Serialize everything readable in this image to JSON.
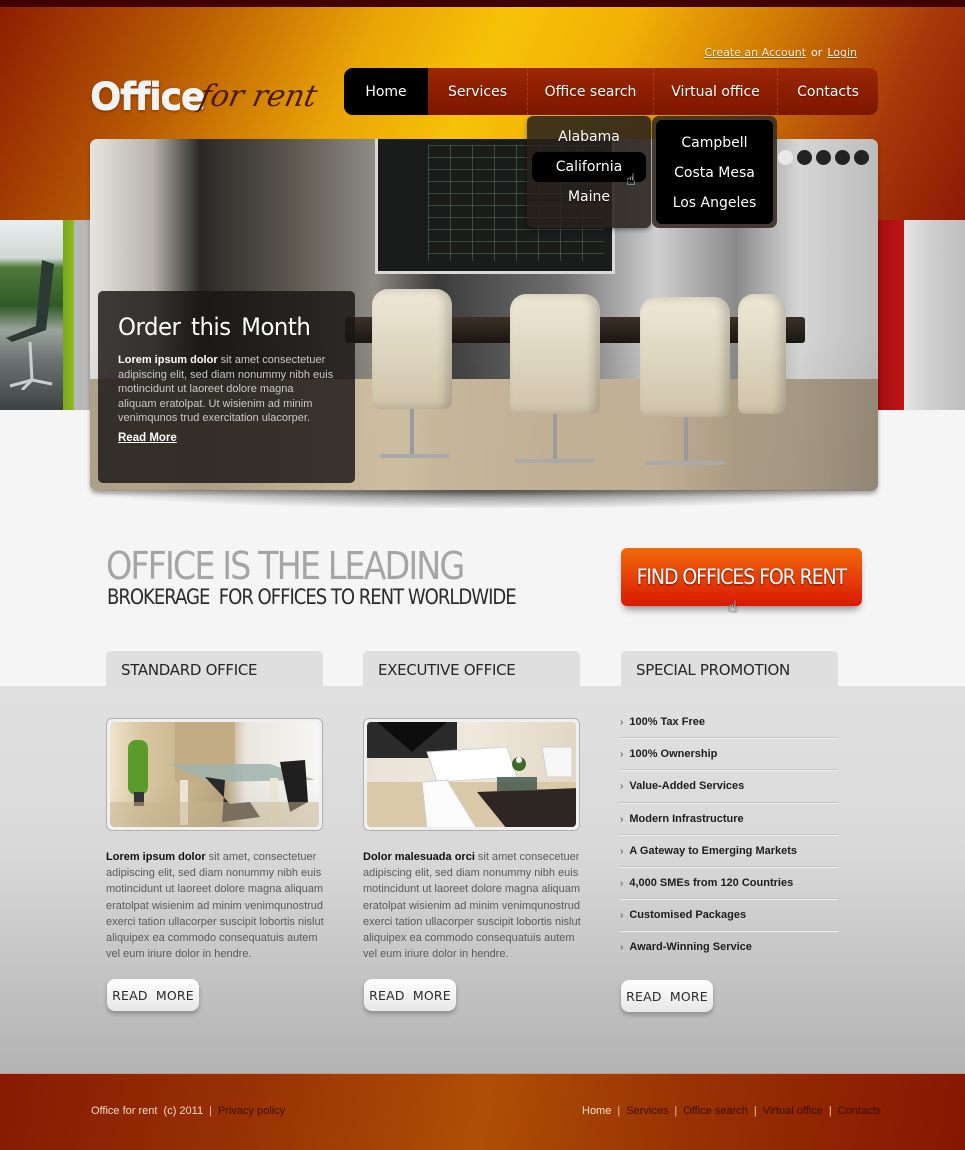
{
  "header": {
    "logo": {
      "main": "Office",
      "script": "for rent"
    },
    "account": {
      "create_label": "Create an Account",
      "or_label": "or",
      "login_label": "Login"
    },
    "nav": [
      {
        "label": "Home",
        "active": true
      },
      {
        "label": "Services",
        "active": false
      },
      {
        "label": "Office search",
        "active": false
      },
      {
        "label": "Virtual office",
        "active": false
      },
      {
        "label": "Contacts",
        "active": false
      }
    ],
    "dropdown_states": [
      {
        "label": "Alabama",
        "hover": false
      },
      {
        "label": "California",
        "hover": true
      },
      {
        "label": "Maine",
        "hover": false
      }
    ],
    "dropdown_cities": [
      {
        "label": "Campbell"
      },
      {
        "label": "Costa Mesa"
      },
      {
        "label": "Los Angeles"
      }
    ]
  },
  "banner": {
    "title": "Order  this Month",
    "text_bold": "Lorem ipsum dolor",
    "text": " sit amet consectetuer adipiscing elit, sed diam nonummy nibh euis motincidunt ut laoreet dolore magna aliquam eratolpat. Ut wisienim ad minim venimqunos trud exercitation ulacorper.",
    "read_more": "Read More",
    "slides_total": 5,
    "active_slide": 1
  },
  "slogan": {
    "line1": "OFFICE IS THE LEADING",
    "line2": "BROKERAGE  FOR OFFICES TO RENT WORLDWIDE",
    "cta": "FIND OFFICES FOR RENT"
  },
  "columns": [
    {
      "title": "STANDARD OFFICE",
      "text_bold": "Lorem ipsum dolor",
      "text": " sit amet, consectetuer adipiscing elit, sed diam nonummy nibh euis motincidunt ut laoreet dolore magna aliquam eratolpat wisienim ad minim venimqunostrud exerci tation ullacorper suscipit lobortis nislut aliquipex ea commodo consequatuis autem vel eum iriure dolor in hendre.",
      "button": "READ  MORE"
    },
    {
      "title": "EXECUTIVE OFFICE",
      "text_bold": "Dolor malesuada orci",
      "text": " sit amet consecetuer adipiscing elit, sed diam nonummy nibh euis motincidunt ut laoreet dolore magna aliquam eratolpat wisienim ad minim venimqunostrud exerci tation ullacorper suscipit lobortis nislut aliquipex ea commodo consequatuis autem vel eum iriure dolor in hendre.",
      "button": "READ  MORE"
    },
    {
      "title": "SPECIAL PROMOTION",
      "items": [
        "100% Tax Free",
        "100% Ownership",
        "Value-Added Services",
        "Modern Infrastructure",
        "A Gateway to Emerging Markets",
        "4,000 SMEs from 120 Countries",
        "Customised Packages",
        "Award-Winning Service"
      ],
      "button": "READ  MORE"
    }
  ],
  "footer": {
    "copyright": "Office for rent  (c) 2011",
    "separator": "|",
    "privacy": "Privacy policy",
    "links": [
      {
        "label": "Home",
        "active": true
      },
      {
        "label": "Services",
        "active": false
      },
      {
        "label": "Office search",
        "active": false
      },
      {
        "label": "Virtual office",
        "active": false
      },
      {
        "label": "Contacts",
        "active": false
      }
    ]
  },
  "icons": {
    "list_arrow": "›",
    "hand_cursor": "☝"
  },
  "colors": {
    "nav_bg": "#8a1e02",
    "nav_active": "#000000",
    "cta": "#e84508",
    "footer": "#973104",
    "header_gold": "#f6c208"
  }
}
